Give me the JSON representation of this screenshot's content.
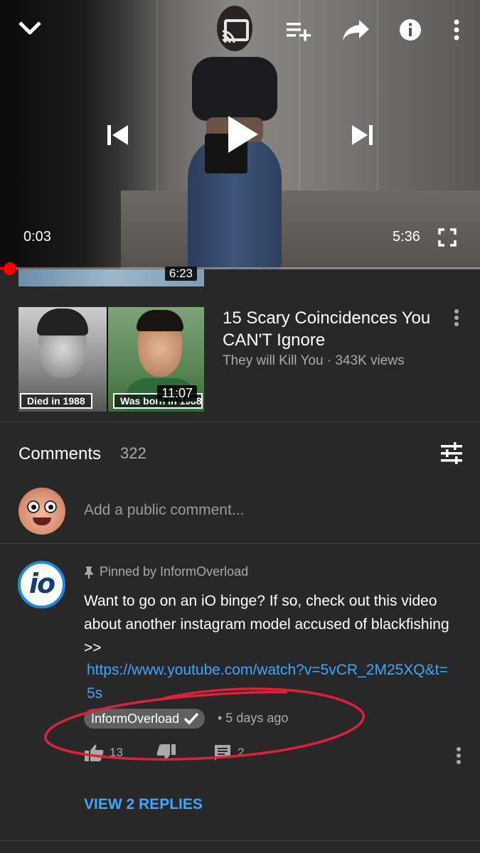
{
  "player": {
    "current_time": "0:03",
    "duration": "5:36",
    "progress_fraction": 0.009,
    "icons": [
      "chevron-down-icon",
      "cast-icon",
      "add-to-queue-icon",
      "share-icon",
      "info-icon",
      "more-vert-icon",
      "previous-icon",
      "play-icon",
      "next-icon",
      "fullscreen-icon"
    ]
  },
  "previous_video": {
    "duration": "6:23"
  },
  "related_video": {
    "title": "15 Scary Coincidences You CAN'T Ignore",
    "meta": "They will Kill You · 343K views",
    "duration": "11:07",
    "caption_left": "Died in 1988",
    "caption_right": "Was born in 1988"
  },
  "comments": {
    "title": "Comments",
    "count": "322",
    "add_placeholder": "Add a public comment...",
    "pinned": {
      "pinned_label": "Pinned by InformOverload",
      "text": "Want to go on an iO binge? If so, check out this video about another instagram model accused of blackfishing >>",
      "link": "https://www.youtube.com/watch?v=5vCR_2M25XQ&t=5s",
      "author": "InformOverload",
      "time_ago": "• 5 days ago",
      "likes": "13",
      "reply_count": "2",
      "avatar_text": "io",
      "view_replies": "VIEW 2 REPLIES"
    }
  },
  "colors": {
    "background": "#282828",
    "progress": "#ff0000",
    "link": "#3ea6ff",
    "annotation": "#e0203a"
  }
}
